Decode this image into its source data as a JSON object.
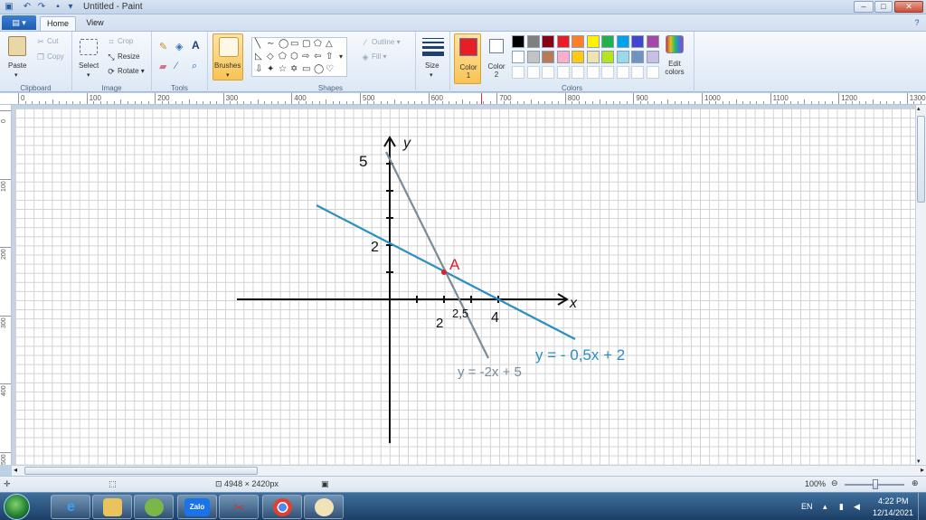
{
  "window": {
    "title": "Untitled - Paint"
  },
  "tabs": [
    {
      "label": "Home"
    },
    {
      "label": "View"
    }
  ],
  "ribbon": {
    "clipboard": {
      "paste": "Paste",
      "cut": "Cut",
      "copy": "Copy",
      "label": "Clipboard"
    },
    "image": {
      "select": "Select",
      "crop": "Crop",
      "resize": "Resize",
      "rotate": "Rotate",
      "label": "Image"
    },
    "tools": {
      "label": "Tools"
    },
    "brushes": {
      "label": "Brushes"
    },
    "shapes": {
      "outline": "Outline",
      "fill": "Fill",
      "label": "Shapes"
    },
    "size": {
      "label": "Size"
    },
    "colors": {
      "color1_label": "Color 1",
      "color2_label": "Color 2",
      "edit_label": "Edit colors",
      "label": "Colors",
      "color1": "#e81e25",
      "color2": "#ffffff",
      "palette_row1": [
        "#000000",
        "#7f7f7f",
        "#880015",
        "#ed1c24",
        "#ff7f27",
        "#fff200",
        "#22b14c",
        "#00a2e8",
        "#3f48cc",
        "#a349a4"
      ],
      "palette_row2": [
        "#ffffff",
        "#c3c3c3",
        "#b97a57",
        "#ffaec9",
        "#ffc90e",
        "#efe4b0",
        "#b5e61d",
        "#99d9ea",
        "#7092be",
        "#c8bfe7"
      ]
    }
  },
  "ruler": {
    "h_labels": [
      "0",
      "100",
      "200",
      "300",
      "400",
      "500",
      "600",
      "700",
      "800",
      "900",
      "1000",
      "1100",
      "1200",
      "1300"
    ],
    "v_labels": [
      "0",
      "100",
      "200",
      "300",
      "400",
      "500"
    ]
  },
  "drawing": {
    "y_axis": "y",
    "x_axis": "x",
    "tick_5": "5",
    "tick_2": "2",
    "tick_x2": "2",
    "tick_x25": "2,5",
    "tick_x4": "4",
    "point_label": "A",
    "line1_label": "y = -2x + 5",
    "line2_label": "y = - 0,5x + 2",
    "line1_color": "#7a8a98",
    "line2_color": "#2a8fc0",
    "point_color": "#d6252e"
  },
  "status": {
    "dimensions": "4948 × 2420px",
    "zoom": "100%"
  },
  "taskbar": {
    "apps": [
      "Internet Explorer",
      "Windows Explorer",
      "Greenshot",
      "Zalo",
      "Snipping Tool",
      "Chrome",
      "Paint"
    ],
    "zalo_label": "Zalo",
    "language": "EN",
    "time": "4:22 PM",
    "date": "12/14/2021"
  }
}
